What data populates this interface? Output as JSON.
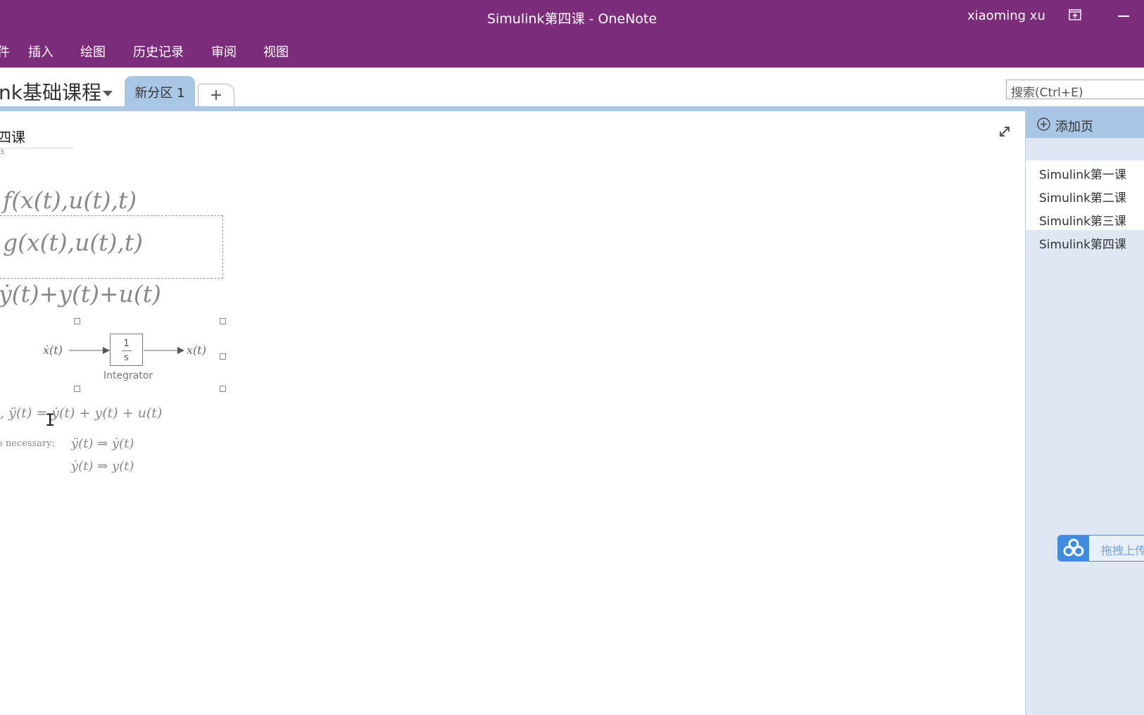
{
  "titlebar": {
    "title": "Simulink第四课  -  OneNote",
    "user": "xiaoming xu"
  },
  "ribbon": {
    "tabs": [
      "件",
      "插入",
      "绘图",
      "历史记录",
      "审阅",
      "视图"
    ]
  },
  "notebook": {
    "title": "nk基础课程",
    "section_tab": "新分区 1",
    "add_tab": "+",
    "search_placeholder": "搜索(Ctrl+E)"
  },
  "page": {
    "title": "四课",
    "date": "3",
    "equations": {
      "eq1": "f(x(t),u(t),t)",
      "eq2": "g(x(t),u(t),t)",
      "eq3": "ẏ(t)+y(t)+u(t)",
      "eq4": ", ÿ(t) = ẏ(t) + y(t) + u(t)",
      "necessary": "e necessary:",
      "eq5": "ÿ(t) ⇒ ẏ(t)",
      "eq6": "ẏ(t) ⇒ y(t)"
    },
    "diagram": {
      "input_label": "ẋ(t)",
      "output_label": "x(t)",
      "block_num": "1",
      "block_den": "s",
      "caption": "Integrator"
    }
  },
  "pagepane": {
    "add_page": "添加页",
    "pages": [
      "Simulink第一课",
      "Simulink第二课",
      "Simulink第三课",
      "Simulink第四课"
    ],
    "active_index": 3
  },
  "upload": {
    "text": "拖拽上传"
  },
  "colors": {
    "titlebar": "#7b2c7a",
    "accent": "#a9c6e4",
    "pane": "#dde8f4",
    "upload_blue": "#3f8be0"
  }
}
